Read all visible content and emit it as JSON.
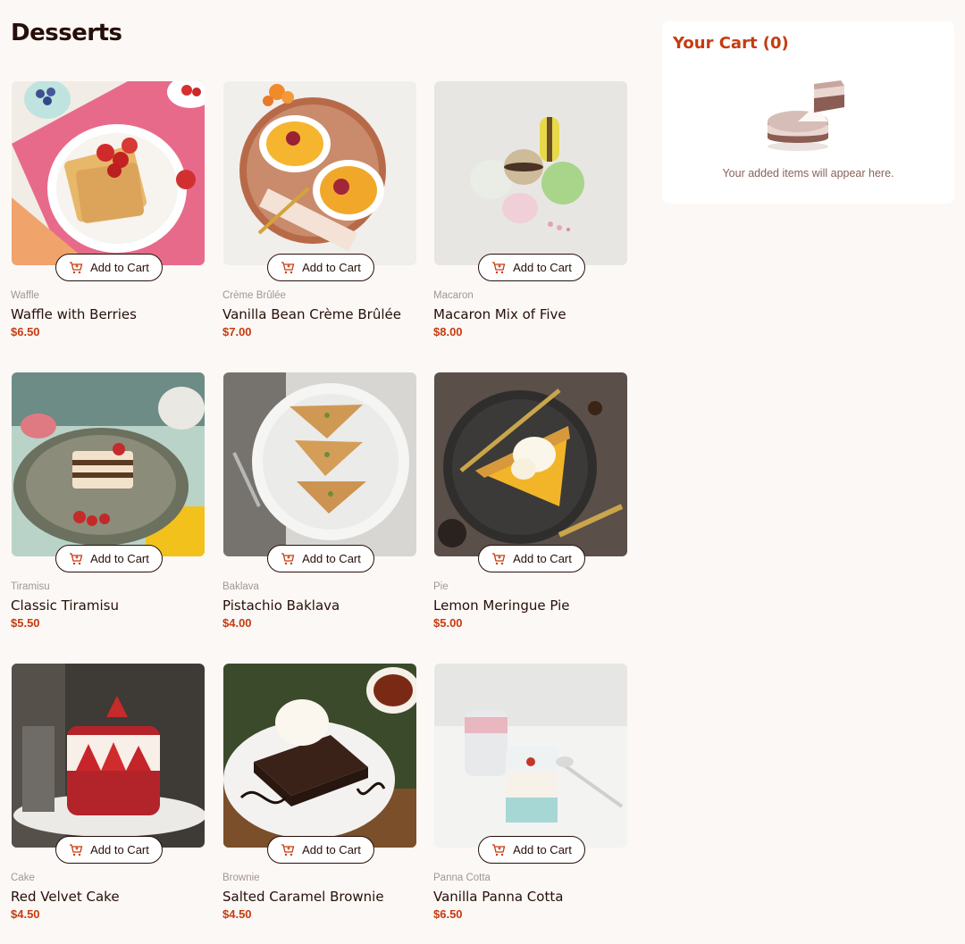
{
  "page": {
    "title": "Desserts"
  },
  "colors": {
    "accent": "#c73b0f",
    "text": "#260f08",
    "muted": "#a19794",
    "background": "#fcf8f6"
  },
  "products": [
    {
      "category": "Waffle",
      "name": "Waffle with Berries",
      "price": "$6.50",
      "button": "Add to Cart",
      "icon": "add-to-cart-icon"
    },
    {
      "category": "Crème Brûlée",
      "name": "Vanilla Bean Crème Brûlée",
      "price": "$7.00",
      "button": "Add to Cart",
      "icon": "add-to-cart-icon"
    },
    {
      "category": "Macaron",
      "name": "Macaron Mix of Five",
      "price": "$8.00",
      "button": "Add to Cart",
      "icon": "add-to-cart-icon"
    },
    {
      "category": "Tiramisu",
      "name": "Classic Tiramisu",
      "price": "$5.50",
      "button": "Add to Cart",
      "icon": "add-to-cart-icon"
    },
    {
      "category": "Baklava",
      "name": "Pistachio Baklava",
      "price": "$4.00",
      "button": "Add to Cart",
      "icon": "add-to-cart-icon"
    },
    {
      "category": "Pie",
      "name": "Lemon Meringue Pie",
      "price": "$5.00",
      "button": "Add to Cart",
      "icon": "add-to-cart-icon"
    },
    {
      "category": "Cake",
      "name": "Red Velvet Cake",
      "price": "$4.50",
      "button": "Add to Cart",
      "icon": "add-to-cart-icon"
    },
    {
      "category": "Brownie",
      "name": "Salted Caramel Brownie",
      "price": "$4.50",
      "button": "Add to Cart",
      "icon": "add-to-cart-icon"
    },
    {
      "category": "Panna Cotta",
      "name": "Vanilla Panna Cotta",
      "price": "$6.50",
      "button": "Add to Cart",
      "icon": "add-to-cart-icon"
    }
  ],
  "cart": {
    "title": "Your Cart (0)",
    "empty_message": "Your added items will appear here.",
    "illustration": "empty-cart-cake-icon"
  }
}
